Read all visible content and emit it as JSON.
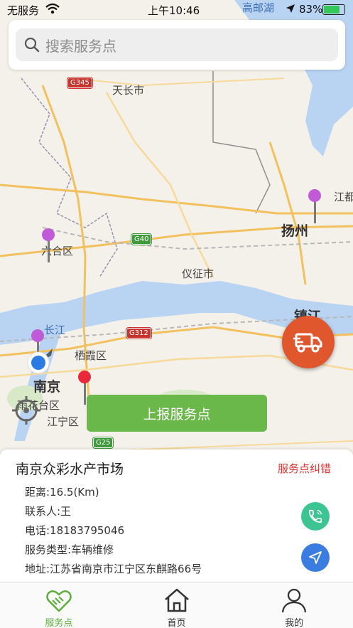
{
  "status": {
    "carrier": "无服务",
    "time": "上午10:46",
    "battery": "83%",
    "battery_level": 0.83
  },
  "search": {
    "placeholder": "搜索服务点"
  },
  "map": {
    "labels": {
      "tianchang": "天长市",
      "gaoyouhu": "高邮湖",
      "yangzhou": "扬州",
      "jiang": "江都",
      "liuhe": "六合区",
      "yizheng": "仪征市",
      "zhenjiang": "镇江",
      "changjiang": "长江",
      "qixia": "栖霞区",
      "nanjing": "南京",
      "yuhuatai": "雨花台区",
      "jiangning": "江宁区"
    },
    "highways": {
      "g345": "G345",
      "g40": "G40",
      "g312": "G312",
      "g25": "G25"
    }
  },
  "report_button": "上报服务点",
  "detail": {
    "name": "南京众彩水产市场",
    "correction": "服务点纠错",
    "distance": "距离:16.5(Km)",
    "contact": "联系人:王",
    "phone": "电话:18183795046",
    "service_type": "服务类型:车辆维修",
    "address": "地址:江苏省南京市江宁区东麒路66号"
  },
  "tabs": [
    {
      "label": "服务点",
      "icon": "handshake-icon",
      "active": true
    },
    {
      "label": "首页",
      "icon": "home-icon",
      "active": false
    },
    {
      "label": "我的",
      "icon": "user-icon",
      "active": false
    }
  ],
  "colors": {
    "accent_green": "#6ab84a",
    "truck_orange": "#e0572e",
    "error_red": "#e0332e",
    "call_green": "#3dc493",
    "nav_blue": "#3a7ce0"
  }
}
